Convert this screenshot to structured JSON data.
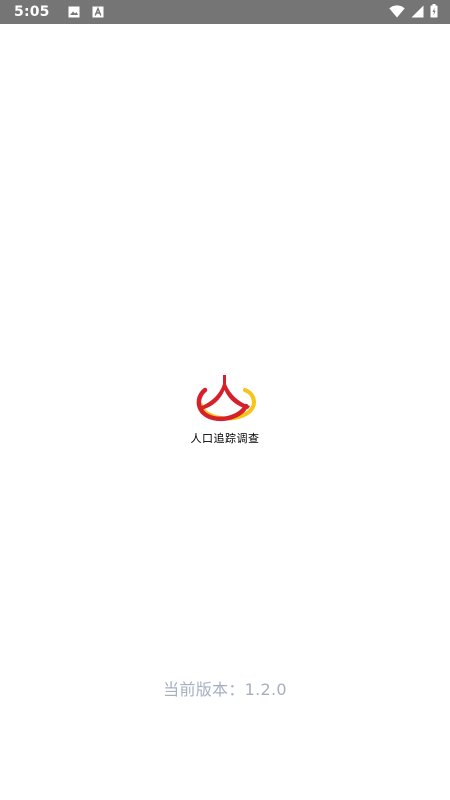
{
  "status_bar": {
    "time": "5:05",
    "icons": [
      "image-icon",
      "text-a-icon",
      "wifi-icon",
      "cell-signal-icon",
      "battery-icon"
    ]
  },
  "splash": {
    "logo_name": "人口追踪调查"
  },
  "version": {
    "label": "当前版本：1.2.0"
  },
  "colors": {
    "status_bar_bg": "#757575",
    "logo_red": "#d6202a",
    "logo_yellow": "#f5c518",
    "version_text": "#a5b0c2"
  }
}
